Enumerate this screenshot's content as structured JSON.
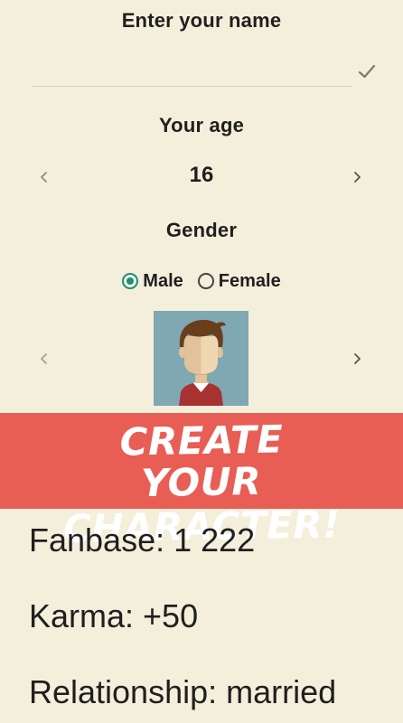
{
  "name_section": {
    "title": "Enter your name",
    "value": "",
    "placeholder": ""
  },
  "age_section": {
    "title": "Your age",
    "value": "16"
  },
  "gender_section": {
    "title": "Gender",
    "options": [
      {
        "label": "Male",
        "selected": true
      },
      {
        "label": "Female",
        "selected": false
      }
    ]
  },
  "banner": {
    "line1": "CREATE",
    "line2": "YOUR CHARACTER!"
  },
  "stats": {
    "fanbase": "Fanbase: 1 222",
    "karma": "Karma: +50",
    "relationship": "Relationship: married"
  },
  "icons": {
    "confirm": "checkmark-icon",
    "prev": "chevron-left-icon",
    "next": "chevron-right-icon",
    "avatar": "avatar-portrait"
  },
  "colors": {
    "background": "#f4efdb",
    "banner": "#e85d54",
    "radio_accent": "#17907f",
    "avatar_bg": "#7fa8b3"
  }
}
